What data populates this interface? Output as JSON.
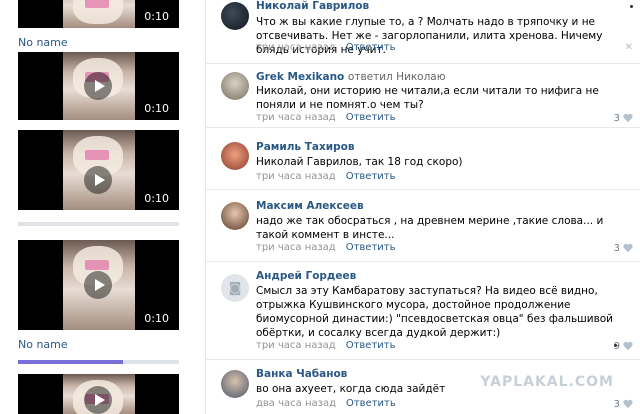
{
  "videos": [
    {
      "duration": "0:10",
      "title": "No name"
    },
    {
      "duration": "0:10",
      "title": ""
    },
    {
      "duration": "0:10",
      "title": ""
    },
    {
      "duration": "0:10",
      "title": "No name"
    },
    {
      "duration": "",
      "title": ""
    }
  ],
  "comments": [
    {
      "author": "Николай Гаврилов",
      "reply_to": "",
      "text": "Что ж вы какие глупые то, а ? Молчать надо в тряпочку и не отсвечивать. Нет же - загорлопанили, илита хренова. Ничему блядь история не учит.",
      "time": "три часа назад",
      "reply_label": "Ответить",
      "likes": ""
    },
    {
      "author": "Grek Mexikano",
      "reply_to": "ответил Николаю",
      "text": "Николай, они историю не читали,а если читали то нифига не поняли и не помнят.о чем ты?",
      "time": "три часа назад",
      "reply_label": "Ответить",
      "likes": "3"
    },
    {
      "author": "Рамиль Тахиров",
      "reply_to": "",
      "text": "Николай Гаврилов, так 18 год скоро)",
      "time": "три часа назад",
      "reply_label": "Ответить",
      "likes": ""
    },
    {
      "author": "Максим Алексеев",
      "reply_to": "",
      "text": "надо же так обосраться , на древнем мерине ,такие слова... и такой коммент в инсте...",
      "time": "три часа назад",
      "reply_label": "Ответить",
      "likes": "3"
    },
    {
      "author": "Андрей Гордеев",
      "reply_to": "",
      "text": "Смысл за эту Камбаратову заступаться? На видео всё видно, отрыжка Кушвинского мусора, достойное продолжение биомусорной династии:) \"псевдосветская овца\" без фальшивой обёртки, и сосалку всегда дудкой держит:)",
      "time": "три часа назад",
      "reply_label": "Ответить",
      "likes": "9"
    },
    {
      "author": "Ванка Чабанов",
      "reply_to": "",
      "text": "во она ахуеет, когда сюда зайдёт",
      "time": "два часа назад",
      "reply_label": "Ответить",
      "likes": "3"
    }
  ],
  "watermark": "YAPLAKAL.COM",
  "colors": {
    "link": "#2a5885",
    "meta": "#939393",
    "progress": "#7a6fd8"
  },
  "progress": 0.65
}
